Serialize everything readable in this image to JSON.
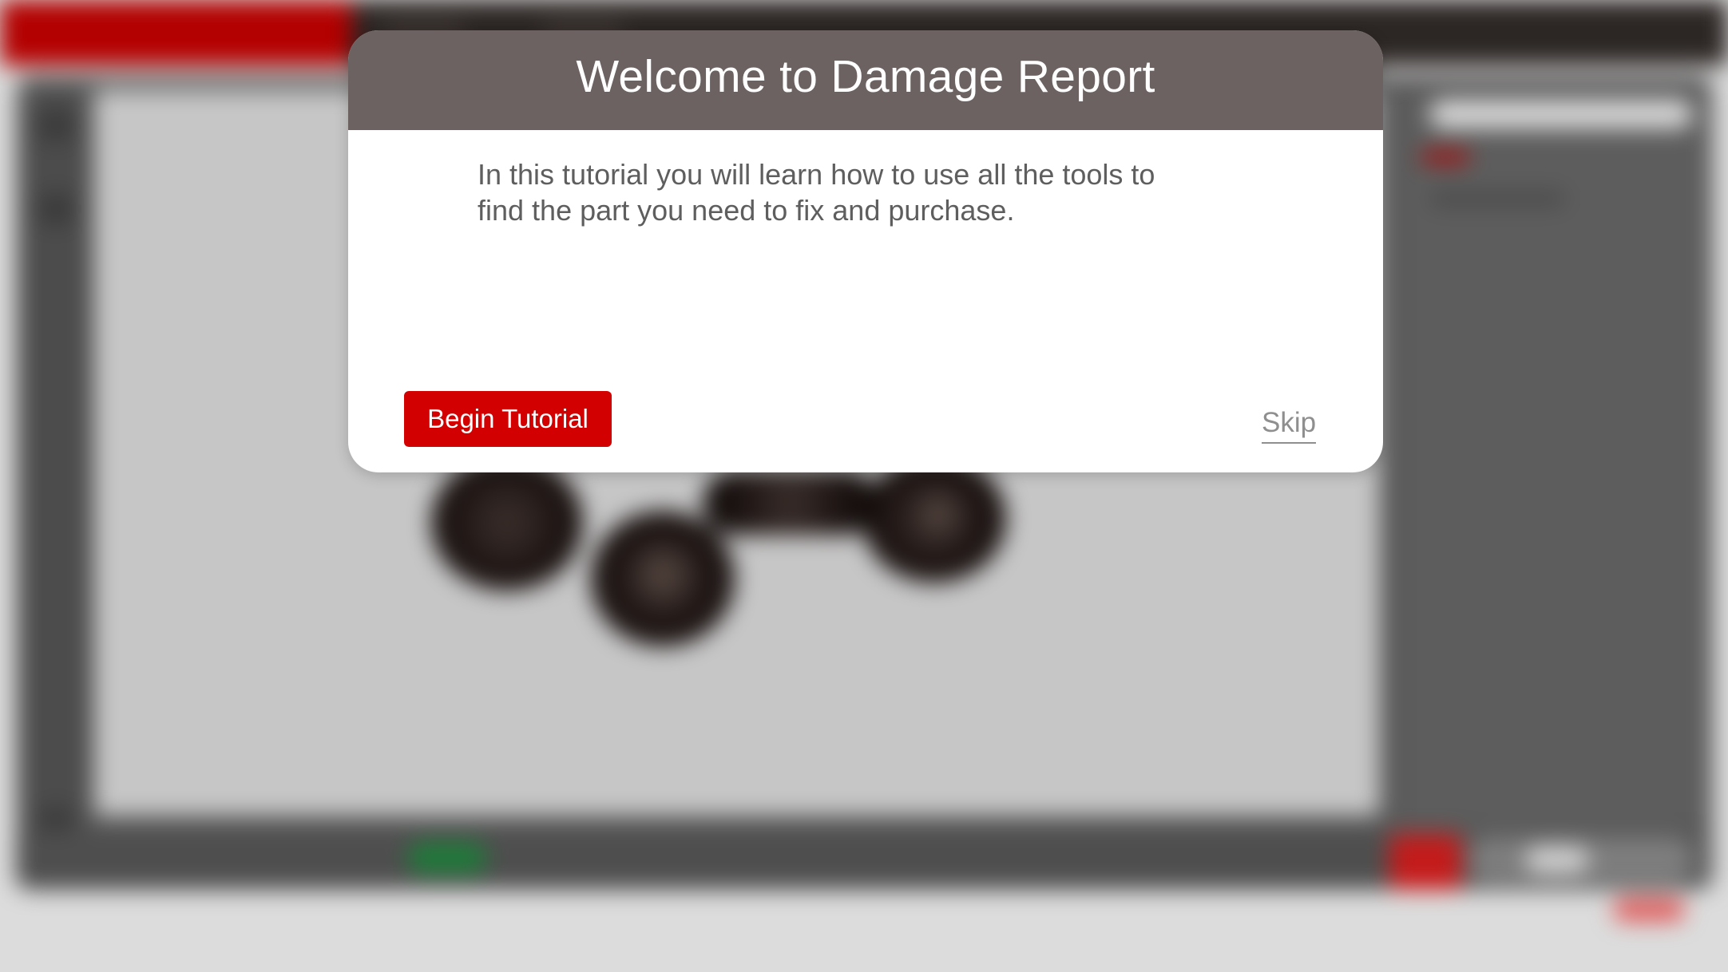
{
  "modal": {
    "title": "Welcome to Damage Report",
    "body_line1": "In this tutorial you will learn how to use all the tools to",
    "body_line2": "find the part you need to fix and purchase.",
    "begin_label": "Begin Tutorial",
    "skip_label": "Skip"
  },
  "colors": {
    "header_bg": "#6b6261",
    "primary_button": "#d20000",
    "brand_red": "#b30000",
    "body_text": "#5e5e5e",
    "skip_text": "#8f8f8f"
  },
  "background": {
    "state": "blurred",
    "viewport_subject": "vehicle-wheels"
  }
}
